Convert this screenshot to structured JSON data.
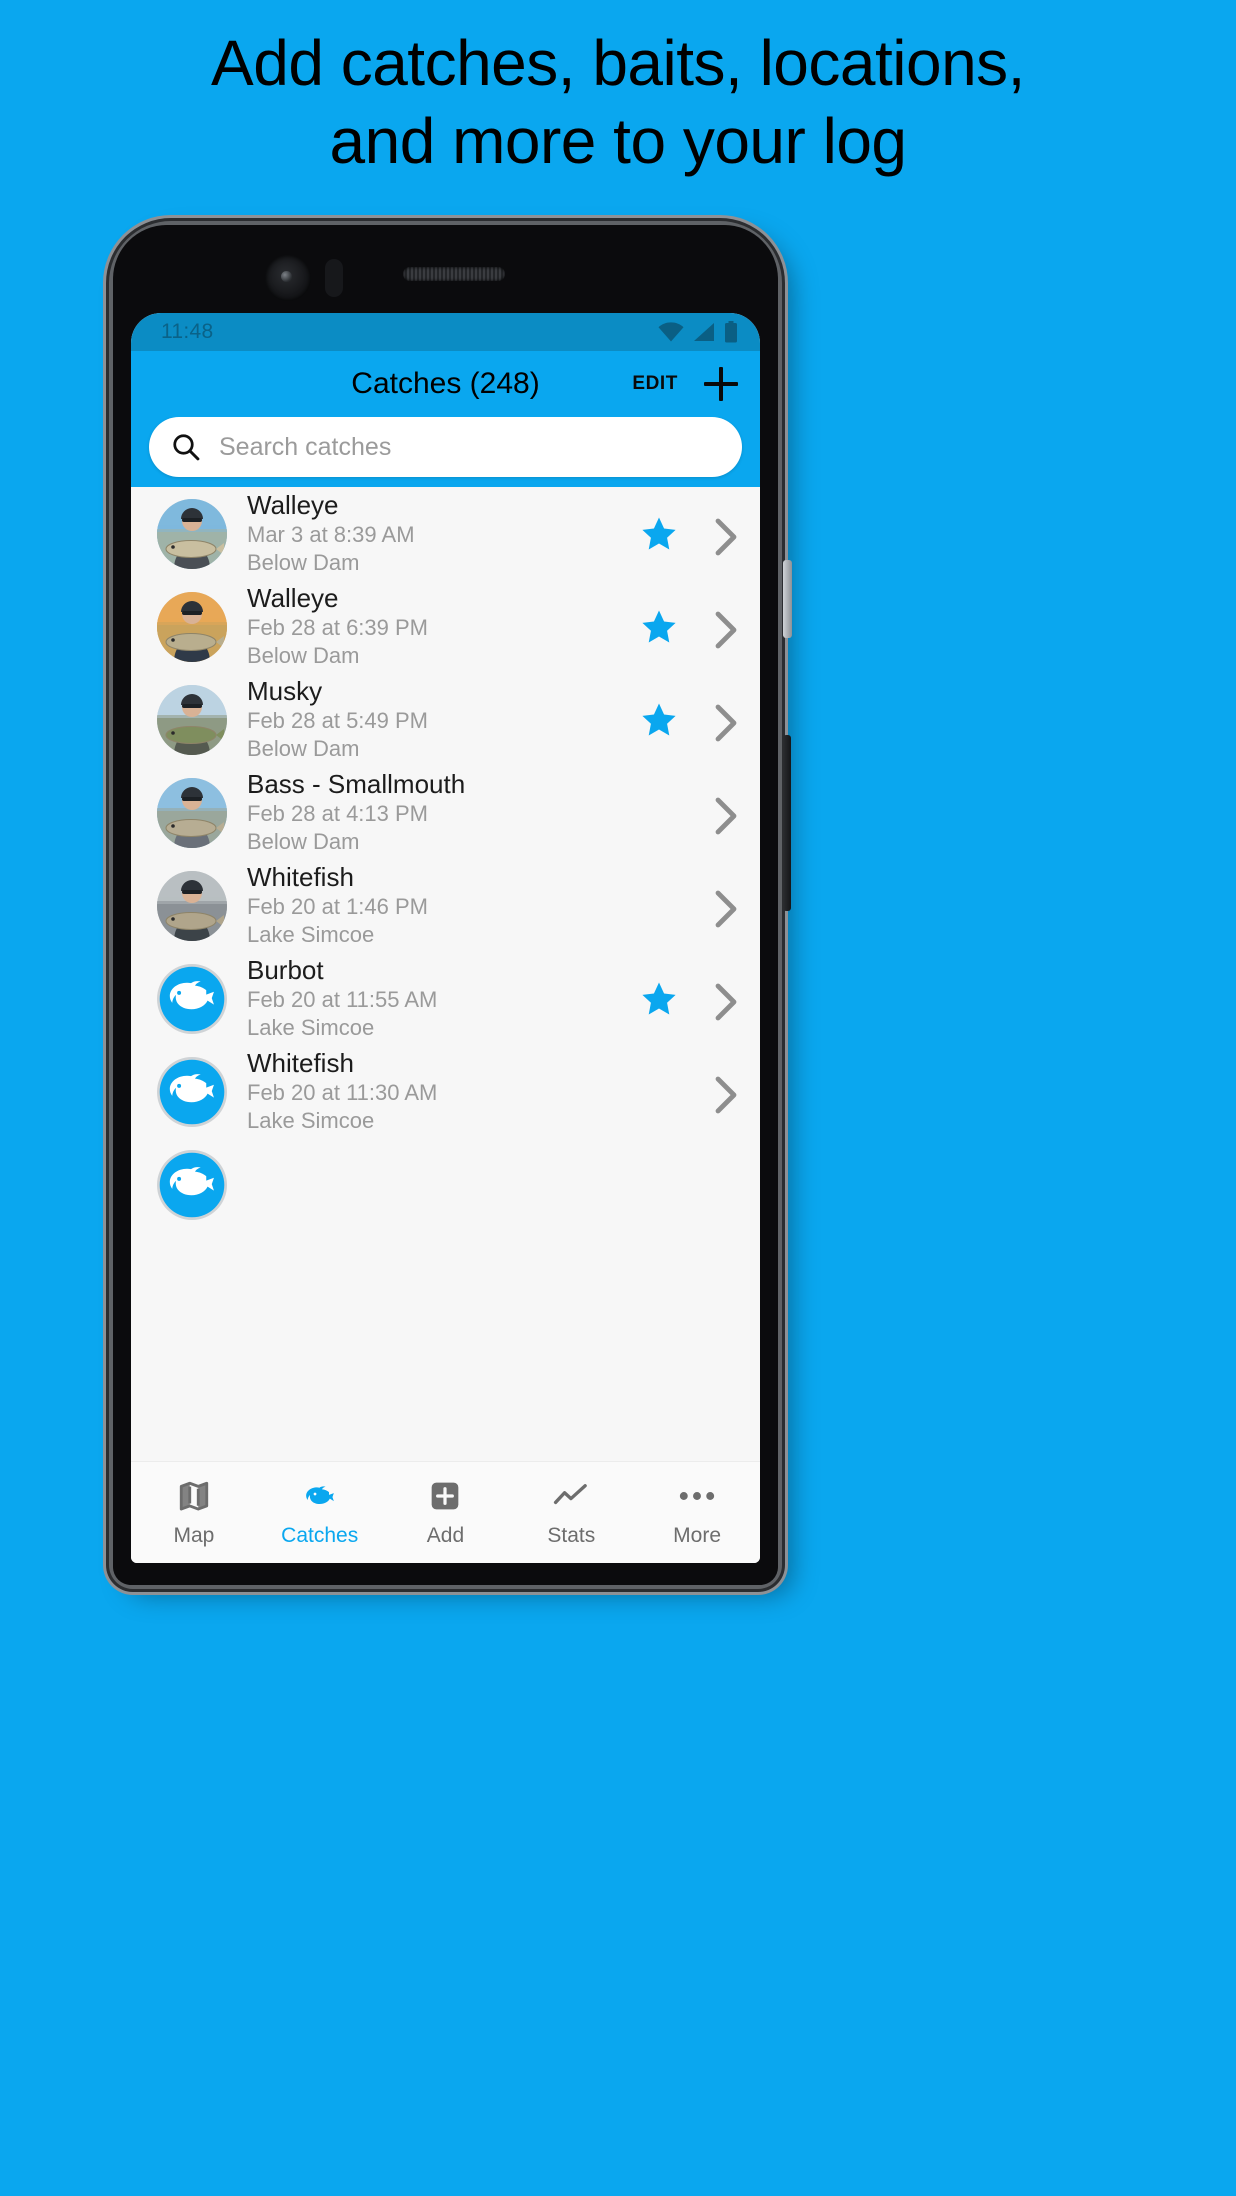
{
  "promo": {
    "headline_line1": "Add catches, baits, locations,",
    "headline_line2": "and more to your log",
    "background_color": "#0aa7ef"
  },
  "phone": {
    "status_bar": {
      "time": "11:48",
      "icons": [
        "wifi-icon",
        "cell-signal-icon",
        "battery-icon"
      ]
    },
    "app_bar": {
      "title": "Catches (248)",
      "edit_label": "EDIT",
      "add_icon": "plus-icon",
      "accent_color": "#0aa7ef"
    },
    "search": {
      "placeholder": "Search catches",
      "value": "",
      "icon": "search-icon"
    },
    "catches": [
      {
        "species": "Walleye",
        "datetime": "Mar 3 at 8:39 AM",
        "location": "Below Dam",
        "favorite": true,
        "avatar": "photo"
      },
      {
        "species": "Walleye",
        "datetime": "Feb 28 at 6:39 PM",
        "location": "Below Dam",
        "favorite": true,
        "avatar": "photo"
      },
      {
        "species": "Musky",
        "datetime": "Feb 28 at 5:49 PM",
        "location": "Below Dam",
        "favorite": true,
        "avatar": "photo"
      },
      {
        "species": "Bass - Smallmouth",
        "datetime": "Feb 28 at 4:13 PM",
        "location": "Below Dam",
        "favorite": false,
        "avatar": "photo"
      },
      {
        "species": "Whitefish",
        "datetime": "Feb 20 at 1:46 PM",
        "location": "Lake Simcoe",
        "favorite": false,
        "avatar": "photo"
      },
      {
        "species": "Burbot",
        "datetime": "Feb 20 at 11:55 AM",
        "location": "Lake Simcoe",
        "favorite": true,
        "avatar": "fish-icon"
      },
      {
        "species": "Whitefish",
        "datetime": "Feb 20 at 11:30 AM",
        "location": "Lake Simcoe",
        "favorite": false,
        "avatar": "fish-icon"
      }
    ],
    "bottom_nav": {
      "items": [
        {
          "label": "Map",
          "icon": "map-icon",
          "active": false
        },
        {
          "label": "Catches",
          "icon": "fish-icon",
          "active": true
        },
        {
          "label": "Add",
          "icon": "plus-box-icon",
          "active": false
        },
        {
          "label": "Stats",
          "icon": "trend-icon",
          "active": false
        },
        {
          "label": "More",
          "icon": "ellipsis-icon",
          "active": false
        }
      ],
      "active_color": "#0aa7ef",
      "inactive_color": "#6d6d6d"
    }
  }
}
